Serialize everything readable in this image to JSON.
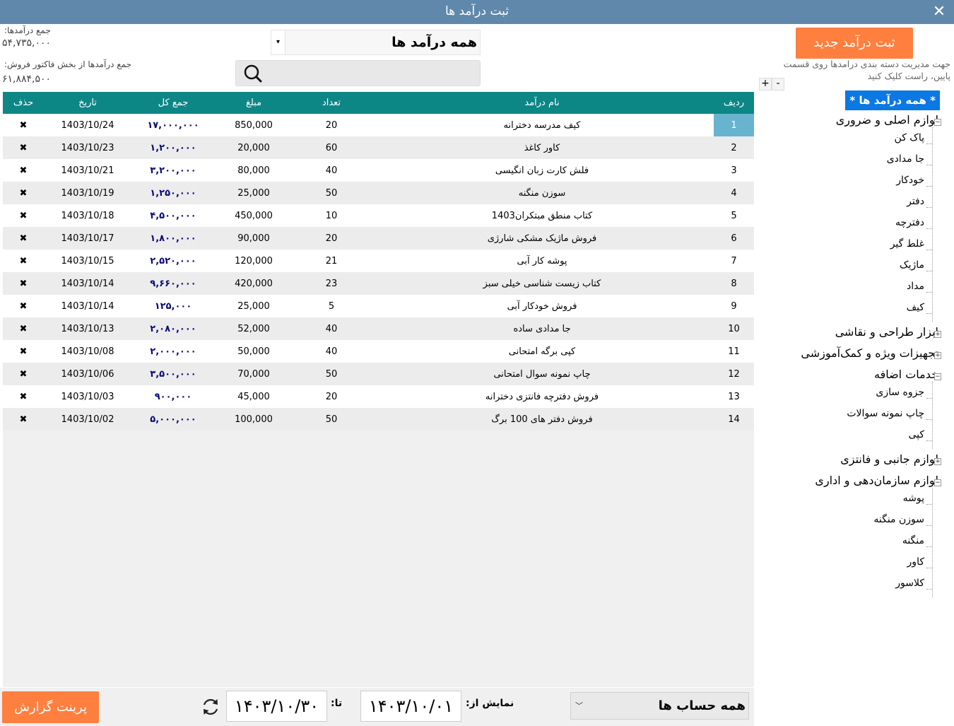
{
  "window": {
    "title": "ثبت درآمد ها",
    "close_label": "✕"
  },
  "totals": {
    "income_label": "جمع درآمدها:",
    "income_value": "۵۴,۷۳۵,۰۰۰",
    "sales_label": "جمع درآمدها از بخش فاکتور فروش:",
    "sales_value": "۶۱,۸۸۴,۵۰۰"
  },
  "category_combo": {
    "value": "همه درآمد ها",
    "arrow": "▾"
  },
  "search": {
    "placeholder": "",
    "icon": "search-icon"
  },
  "table": {
    "columns": [
      "ردیف",
      "نام درآمد",
      "تعداد",
      "مبلغ",
      "جمع کل",
      "تاریخ",
      "حذف"
    ],
    "rows": [
      {
        "rank": "1",
        "name": "کیف مدرسه دخترانه",
        "qty": "20",
        "price": "850,000",
        "total": "۱۷,۰۰۰,۰۰۰",
        "date": "1403/10/24",
        "del": "✖"
      },
      {
        "rank": "2",
        "name": "کاور کاغذ",
        "qty": "60",
        "price": "20,000",
        "total": "۱,۲۰۰,۰۰۰",
        "date": "1403/10/23",
        "del": "✖"
      },
      {
        "rank": "3",
        "name": "فلش کارت زبان انگیسی",
        "qty": "40",
        "price": "80,000",
        "total": "۳,۲۰۰,۰۰۰",
        "date": "1403/10/21",
        "del": "✖"
      },
      {
        "rank": "4",
        "name": "سوزن منگنه",
        "qty": "50",
        "price": "25,000",
        "total": "۱,۲۵۰,۰۰۰",
        "date": "1403/10/19",
        "del": "✖"
      },
      {
        "rank": "5",
        "name": "کتاب منطق مبتکران1403",
        "qty": "10",
        "price": "450,000",
        "total": "۴,۵۰۰,۰۰۰",
        "date": "1403/10/18",
        "del": "✖"
      },
      {
        "rank": "6",
        "name": "فروش ماژیک مشکی شارژی",
        "qty": "20",
        "price": "90,000",
        "total": "۱,۸۰۰,۰۰۰",
        "date": "1403/10/17",
        "del": "✖"
      },
      {
        "rank": "7",
        "name": "پوشه کار آبی",
        "qty": "21",
        "price": "120,000",
        "total": "۲,۵۲۰,۰۰۰",
        "date": "1403/10/15",
        "del": "✖"
      },
      {
        "rank": "8",
        "name": "کتاب زیست شناسی خیلی سبز",
        "qty": "23",
        "price": "420,000",
        "total": "۹,۶۶۰,۰۰۰",
        "date": "1403/10/14",
        "del": "✖"
      },
      {
        "rank": "9",
        "name": "فروش خودکار آبی",
        "qty": "5",
        "price": "25,000",
        "total": "۱۲۵,۰۰۰",
        "date": "1403/10/14",
        "del": "✖"
      },
      {
        "rank": "10",
        "name": "جا مدادی ساده",
        "qty": "40",
        "price": "52,000",
        "total": "۲,۰۸۰,۰۰۰",
        "date": "1403/10/13",
        "del": "✖"
      },
      {
        "rank": "11",
        "name": "کپی برگه امتحانی",
        "qty": "40",
        "price": "50,000",
        "total": "۲,۰۰۰,۰۰۰",
        "date": "1403/10/08",
        "del": "✖"
      },
      {
        "rank": "12",
        "name": "چاپ نمونه سوال امتحانی",
        "qty": "50",
        "price": "70,000",
        "total": "۳,۵۰۰,۰۰۰",
        "date": "1403/10/06",
        "del": "✖"
      },
      {
        "rank": "13",
        "name": "فروش دفترچه فانتزی دخترانه",
        "qty": "20",
        "price": "45,000",
        "total": "۹۰۰,۰۰۰",
        "date": "1403/10/03",
        "del": "✖"
      },
      {
        "rank": "14",
        "name": "فروش دفتر های 100 برگ",
        "qty": "50",
        "price": "100,000",
        "total": "۵,۰۰۰,۰۰۰",
        "date": "1403/10/02",
        "del": "✖"
      }
    ]
  },
  "right_panel": {
    "new_button": "ثبت درآمد جدید",
    "help_text": "جهت مدیریت دسته بندی درامدها روی قسمت پایین، راست کلیک کنید",
    "expand_all": "+",
    "collapse_all": "-",
    "tree": {
      "root": "* همه درآمد ها *",
      "groups": [
        {
          "label": "لوازم اصلی و ضروری",
          "expanded": true,
          "children": [
            "پاک کن",
            "جا مدادی",
            "خودکار",
            "دفتر",
            "دفترچه",
            "غلط گیر",
            "ماژیک",
            "مداد",
            "کیف"
          ]
        },
        {
          "label": "ابزار طراحی و نقاشی",
          "expanded": false,
          "children": []
        },
        {
          "label": "تجهیزات ویژه و کمک‌آموزشی",
          "expanded": false,
          "children": []
        },
        {
          "label": "خدمات اضافه",
          "expanded": true,
          "children": [
            "جزوه سازی",
            "چاپ نمونه سوالات",
            "کپی"
          ]
        },
        {
          "label": "لوازم جانبی و فانتزی",
          "expanded": false,
          "children": []
        },
        {
          "label": "لوازم سازمان‌دهی و اداری",
          "expanded": true,
          "children": [
            "پوشه",
            "سوزن منگنه",
            "منگنه",
            "کاور",
            "کلاسور"
          ]
        }
      ]
    }
  },
  "footer": {
    "print_button": "پرینت گزارش",
    "to_label": "تا:",
    "to_date": "۱۴۰۳/۱۰/۳۰",
    "from_label": "نمایش از:",
    "from_date": "۱۴۰۳/۱۰/۰۱",
    "accounts_value": "همه حساب ها",
    "accounts_arrow": "﹀"
  },
  "colors": {
    "title_bar": "#5f88ab",
    "header": "#0d8686",
    "accent_button": "#ff7f3f",
    "selected_row": "#68b4cf",
    "tree_selected": "#0b78e3",
    "total_text": "#0a0a78"
  }
}
